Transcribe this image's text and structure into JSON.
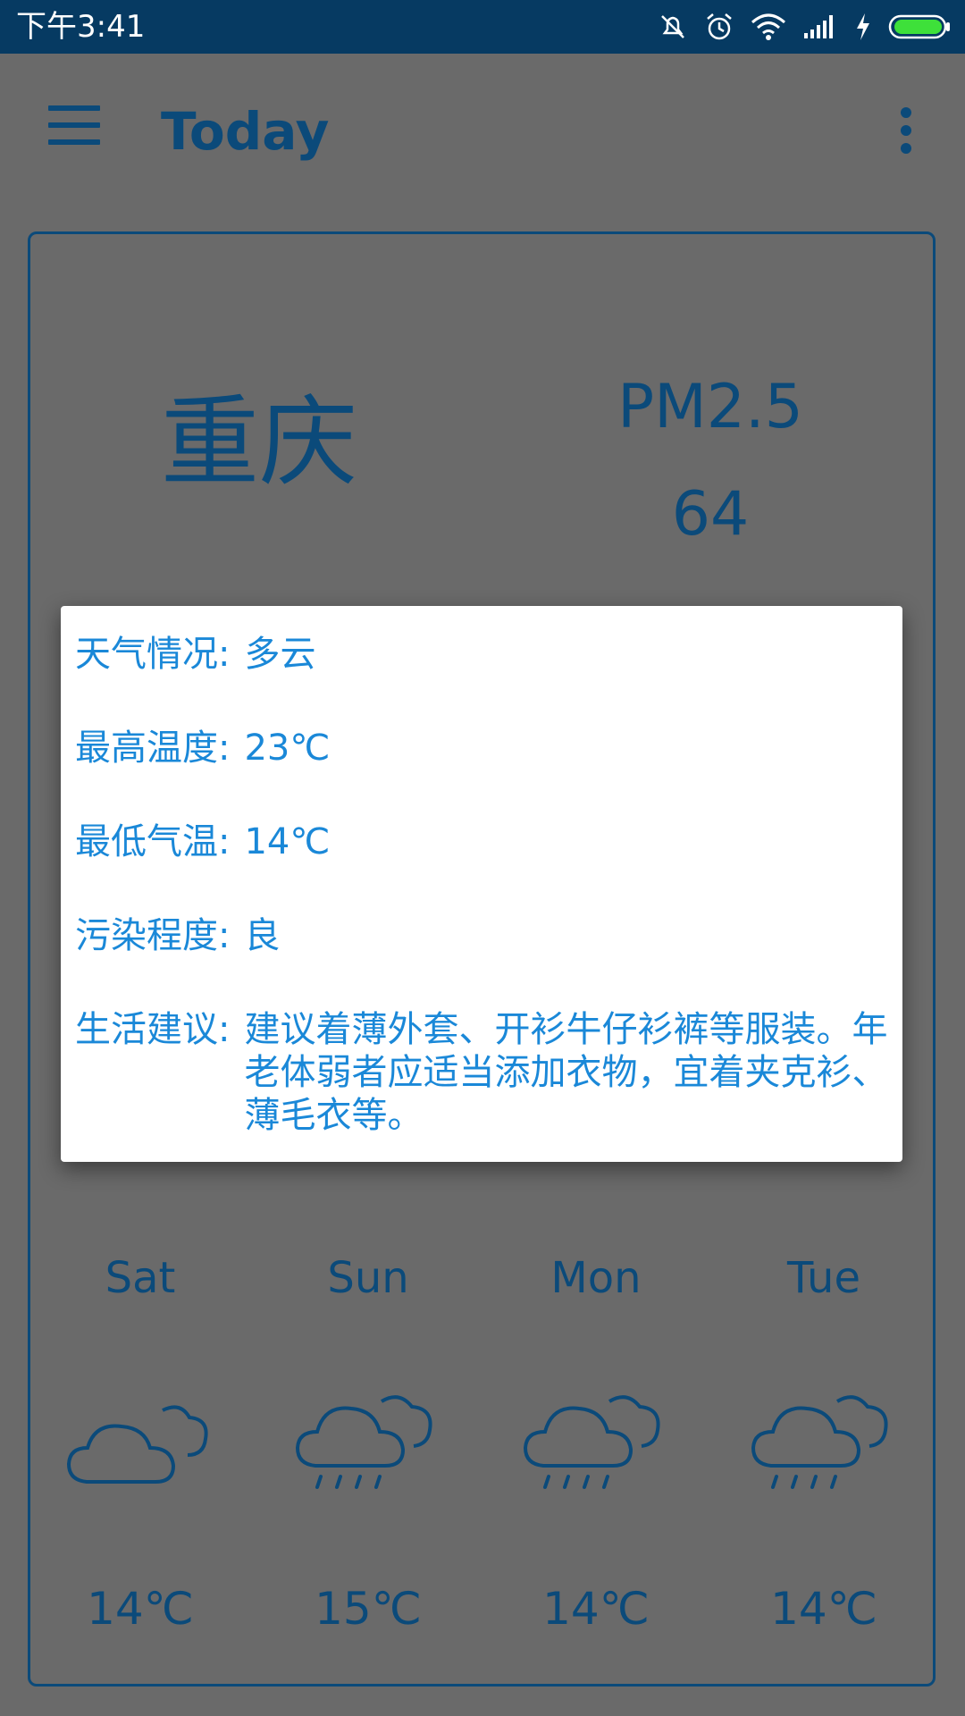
{
  "status_bar": {
    "time": "下午3:41",
    "icons": [
      "mute-icon",
      "alarm-icon",
      "wifi-icon",
      "signal-icon",
      "charging-icon",
      "battery-icon"
    ],
    "background_color": "#063a62"
  },
  "app_bar": {
    "title": "Today",
    "menu_icon": "hamburger-menu-icon",
    "overflow_icon": "more-vert-icon"
  },
  "current": {
    "city": "重庆",
    "pm_label": "PM2.5",
    "pm_value": "64"
  },
  "dialog": {
    "rows": [
      {
        "label": "天气情况:",
        "value": "多云"
      },
      {
        "label": "最高温度:",
        "value": "23℃"
      },
      {
        "label": "最低气温:",
        "value": "14℃"
      },
      {
        "label": "污染程度:",
        "value": "良"
      },
      {
        "label": "生活建议:",
        "value": "建议着薄外套、开衫牛仔衫裤等服装。年老体弱者应适当添加衣物，宜着夹克衫、薄毛衣等。"
      }
    ],
    "text_color": "#1a88d8"
  },
  "forecast": [
    {
      "day": "Sat",
      "icon": "cloudy-icon",
      "temp": "14℃"
    },
    {
      "day": "Sun",
      "icon": "rain-icon",
      "temp": "15℃"
    },
    {
      "day": "Mon",
      "icon": "rain-icon",
      "temp": "14℃"
    },
    {
      "day": "Tue",
      "icon": "rain-icon",
      "temp": "14℃"
    }
  ],
  "colors": {
    "primary": "#0b4a7a",
    "scrim": "#6a6a6a"
  }
}
